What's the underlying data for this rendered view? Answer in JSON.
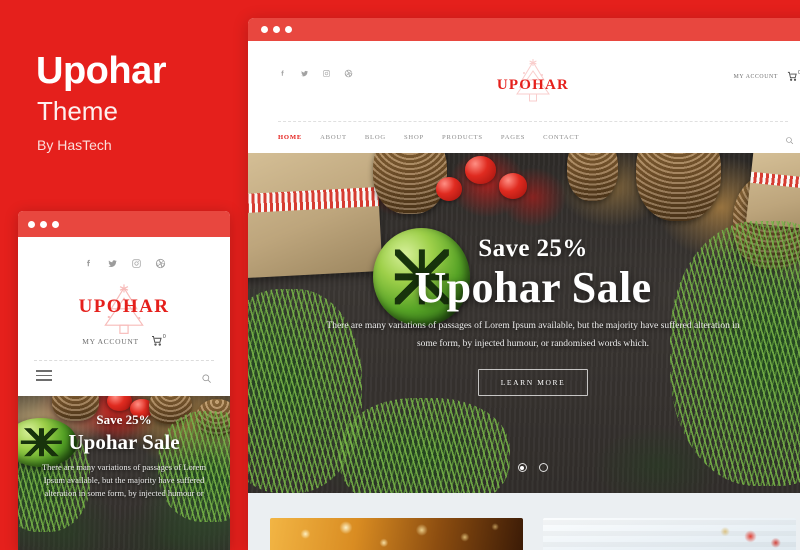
{
  "brand": {
    "title": "Upohar",
    "subtitle": "Theme",
    "author": "By HasTech"
  },
  "colors": {
    "accent_red": "#E5201C",
    "chrome_red": "#E8473F",
    "section_bg": "#EBEFF2",
    "nav_text": "#8D8D8D"
  },
  "site": {
    "logo": "UPOHAR",
    "social": [
      {
        "name": "facebook-icon",
        "label": "Facebook"
      },
      {
        "name": "twitter-icon",
        "label": "Twitter"
      },
      {
        "name": "instagram-icon",
        "label": "Instagram"
      },
      {
        "name": "dribbble-icon",
        "label": "Dribbble"
      }
    ],
    "account_label": "MY ACCOUNT",
    "cart_count": "0",
    "nav": [
      {
        "label": "HOME",
        "active": true
      },
      {
        "label": "ABOUT",
        "active": false
      },
      {
        "label": "BLOG",
        "active": false
      },
      {
        "label": "SHOP",
        "active": false
      },
      {
        "label": "PRODUCTS",
        "active": false
      },
      {
        "label": "PAGES",
        "active": false
      },
      {
        "label": "CONTACT",
        "active": false
      }
    ],
    "search_icon": "search-icon"
  },
  "hero": {
    "eyebrow": "Save 25%",
    "headline": "Upohar Sale",
    "description": "There are many variations of passages of Lorem Ipsum available, but the majority have suffered alteration in some form, by injected humour, or randomised words which.",
    "cta": "LEARN MORE",
    "slides": 2,
    "active_slide": 1
  },
  "mobile": {
    "logo": "UPOHAR",
    "account_label": "MY ACCOUNT",
    "cart_count": "0",
    "menu_icon": "hamburger-menu-icon",
    "search_icon": "search-icon",
    "hero": {
      "eyebrow": "Save 25%",
      "headline": "Upohar Sale",
      "description": "There are many variations of passages of Lorem Ipsum available, but the majority have suffered alteration in some form, by injected humour or"
    }
  },
  "promo_cards": [
    {
      "name": "promo-card-lights"
    },
    {
      "name": "promo-card-gift"
    }
  ],
  "window_controls": {
    "dots": 3
  }
}
